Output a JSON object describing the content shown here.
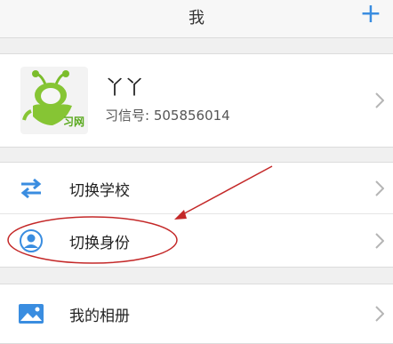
{
  "header": {
    "title": "我",
    "add_symbol": "+"
  },
  "profile": {
    "name": "丫丫",
    "id_text": "习信号: 505856014",
    "logo_text": "习网"
  },
  "menu": {
    "items": [
      {
        "label": "切换学校",
        "icon": "swap-arrows-icon"
      },
      {
        "label": "切换身份",
        "icon": "user-icon"
      }
    ],
    "album": {
      "label": "我的相册",
      "icon": "picture-icon"
    }
  },
  "colors": {
    "accent": "#3a8de0",
    "annotation_red": "#c42828"
  }
}
